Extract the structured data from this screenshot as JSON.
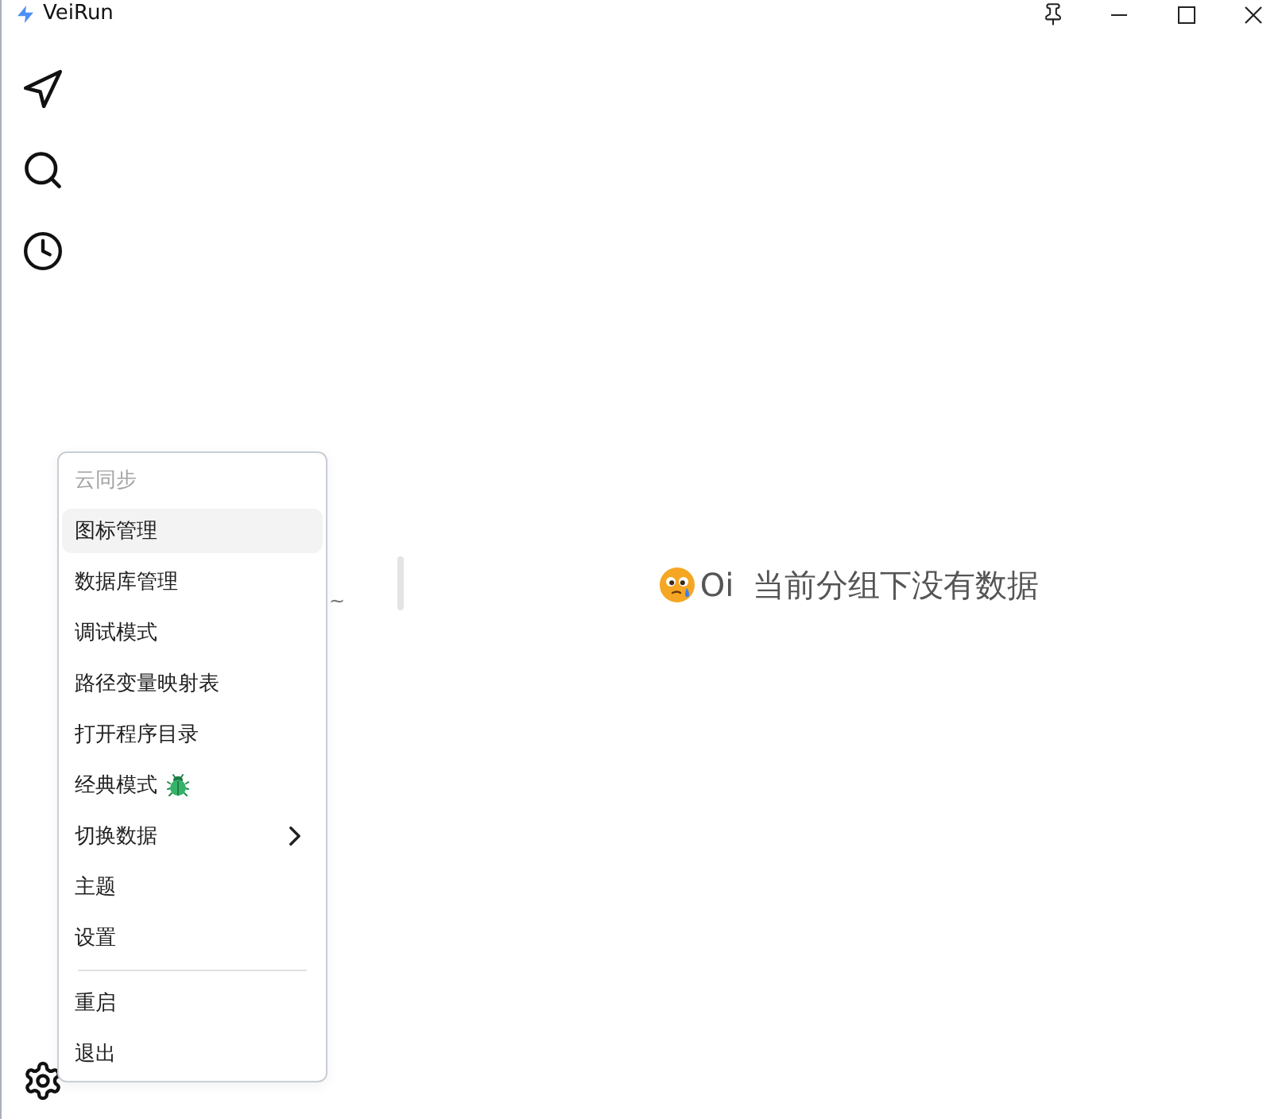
{
  "window": {
    "title": "VeiRun"
  },
  "group_panel": {
    "text_fragment": "~"
  },
  "empty_state": {
    "exclamation": "Oi",
    "message": "当前分组下没有数据"
  },
  "menu": {
    "sections": [
      {
        "items": [
          {
            "label": "云同步",
            "disabled": true,
            "highlighted": false,
            "has_icon": false,
            "submenu": false
          },
          {
            "label": "图标管理",
            "disabled": false,
            "highlighted": true,
            "has_icon": false,
            "submenu": false
          },
          {
            "label": "数据库管理",
            "disabled": false,
            "highlighted": false,
            "has_icon": false,
            "submenu": false
          },
          {
            "label": "调试模式",
            "disabled": false,
            "highlighted": false,
            "has_icon": false,
            "submenu": false
          },
          {
            "label": "路径变量映射表",
            "disabled": false,
            "highlighted": false,
            "has_icon": false,
            "submenu": false
          },
          {
            "label": "打开程序目录",
            "disabled": false,
            "highlighted": false,
            "has_icon": false,
            "submenu": false
          },
          {
            "label": "经典模式",
            "disabled": false,
            "highlighted": false,
            "has_icon": true,
            "submenu": false
          },
          {
            "label": "切换数据",
            "disabled": false,
            "highlighted": false,
            "has_icon": false,
            "submenu": true
          },
          {
            "label": "主题",
            "disabled": false,
            "highlighted": false,
            "has_icon": false,
            "submenu": false
          },
          {
            "label": "设置",
            "disabled": false,
            "highlighted": false,
            "has_icon": false,
            "submenu": false
          }
        ]
      },
      {
        "items": [
          {
            "label": "重启",
            "disabled": false,
            "highlighted": false,
            "has_icon": false,
            "submenu": false
          },
          {
            "label": "退出",
            "disabled": false,
            "highlighted": false,
            "has_icon": false,
            "submenu": false
          }
        ]
      }
    ]
  }
}
